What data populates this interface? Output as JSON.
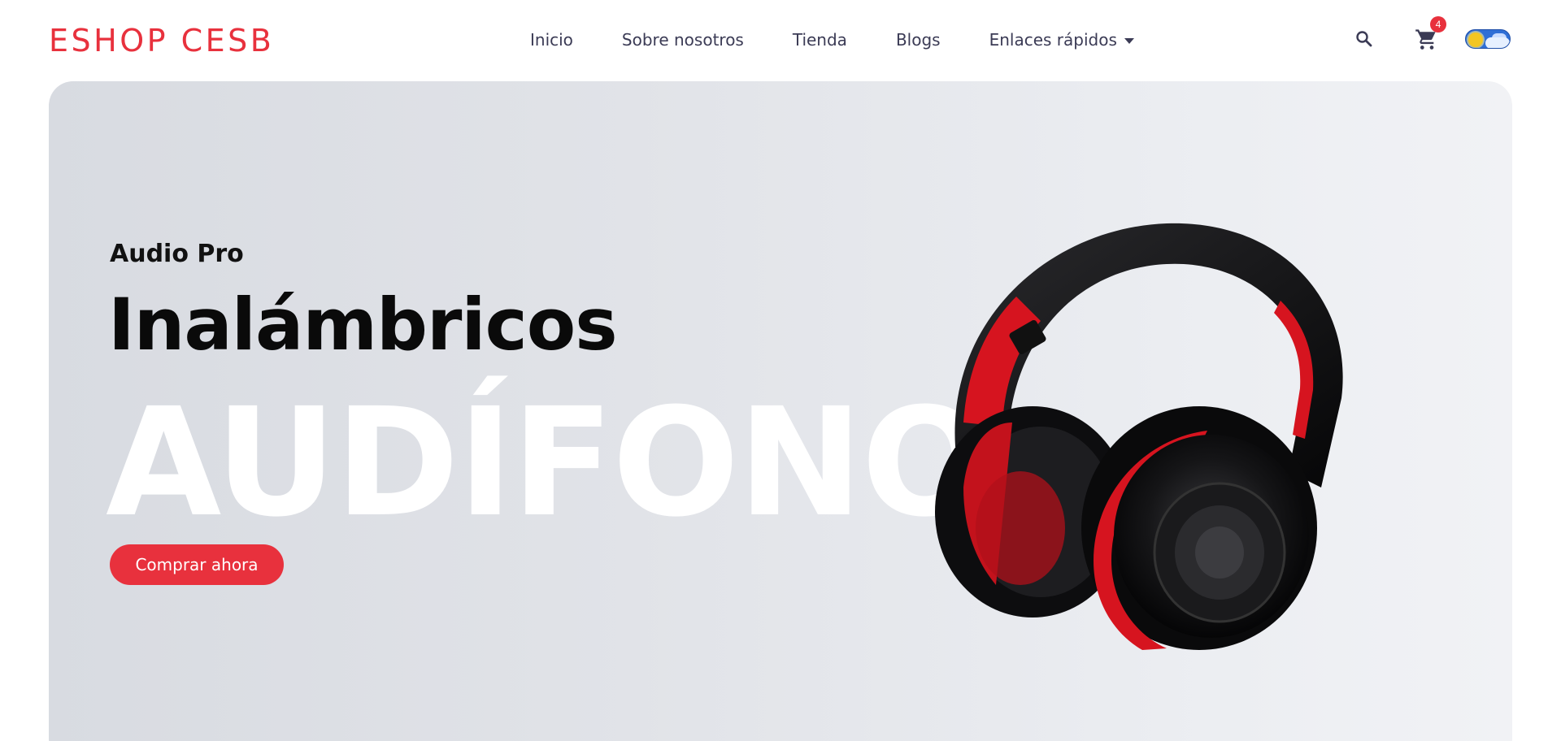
{
  "header": {
    "logo": "ESHOP CESB",
    "nav": [
      {
        "label": "Inicio"
      },
      {
        "label": "Sobre nosotros"
      },
      {
        "label": "Tienda"
      },
      {
        "label": "Blogs"
      },
      {
        "label": "Enlaces rápidos",
        "dropdown": true
      }
    ],
    "search_icon": "search-icon",
    "cart_icon": "shopping-cart-icon",
    "cart_count": "4",
    "theme_toggle_icon": "sun-cloud-toggle-icon"
  },
  "hero": {
    "subtitle": "Audio Pro",
    "title": "Inalámbricos",
    "big_text": "AUDÍFONO",
    "cta_label": "Comprar ahora",
    "image": "headphones-image"
  },
  "colors": {
    "accent": "#e8313d",
    "nav_text": "#3b3b55",
    "hero_bg_start": "#d8dbe1",
    "hero_bg_end": "#f1f2f5"
  }
}
